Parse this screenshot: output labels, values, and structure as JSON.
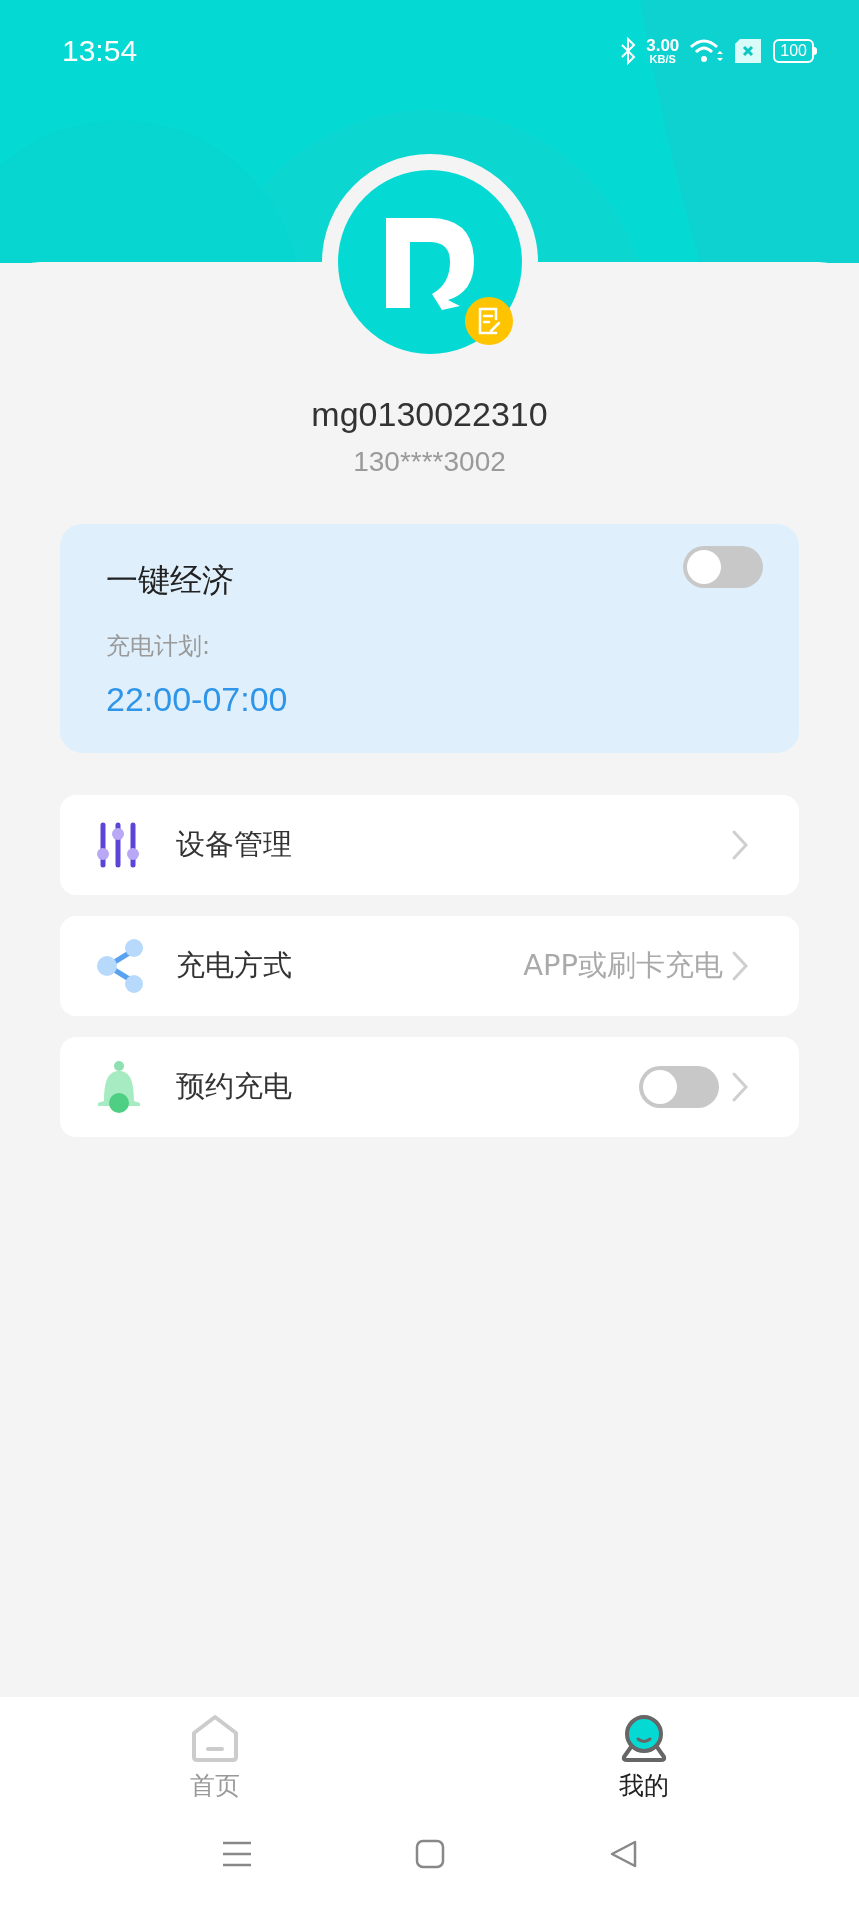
{
  "status_bar": {
    "time": "13:54",
    "net_speed": "3.00",
    "net_unit": "KB/S",
    "battery": "100"
  },
  "profile": {
    "username": "mg0130022310",
    "phone": "130****3002"
  },
  "economy": {
    "title": "一键经济",
    "on": false,
    "plan_label": "充电计划:",
    "plan_time": "22:00-07:00"
  },
  "menu": [
    {
      "kind": "link",
      "label": "设备管理"
    },
    {
      "kind": "value",
      "label": "充电方式",
      "value": "APP或刷卡充电"
    },
    {
      "kind": "toggle",
      "label": "预约充电",
      "on": false
    }
  ],
  "tabs": [
    {
      "label": "首页",
      "selected": false
    },
    {
      "label": "我的",
      "selected": true
    }
  ]
}
